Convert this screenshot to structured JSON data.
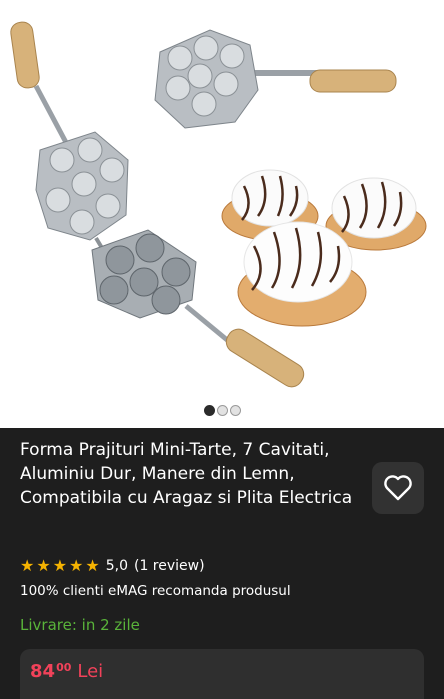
{
  "gallery": {
    "images_count": 3,
    "active_index": 0
  },
  "product": {
    "title": "Forma Prajituri Mini-Tarte, 7 Cavitati, Aluminiu Dur, Manere din Lemn, Compatibila cu Aragaz si Plita Electrica",
    "rating": {
      "stars": 5,
      "value_text": "5,0",
      "reviews_text": "(1 review)"
    },
    "recommend_text": "100% clienti eMAG recomanda produsul",
    "delivery_text": "Livrare: in 2 zile",
    "price": {
      "main": "84",
      "decimals": "00",
      "currency": "Lei"
    }
  },
  "icons": {
    "favorite": "heart-outline-icon",
    "star": "star-icon"
  },
  "colors": {
    "background": "#1e1e1e",
    "star": "#f5b301",
    "delivery": "#59b33a",
    "price": "#f2425a",
    "card": "#2f2f2f"
  }
}
